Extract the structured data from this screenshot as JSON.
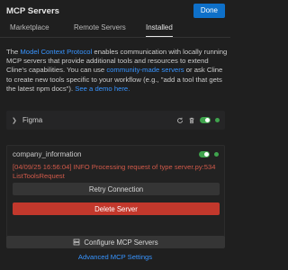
{
  "header": {
    "title": "MCP Servers",
    "done_label": "Done"
  },
  "tabs": [
    {
      "label": "Marketplace",
      "active": false
    },
    {
      "label": "Remote Servers",
      "active": false
    },
    {
      "label": "Installed",
      "active": true
    }
  ],
  "intro": {
    "text_1": "The ",
    "link_1": "Model Context Protocol",
    "text_2": " enables communication with locally running MCP servers that provide additional tools and resources to extend Cline's capabilities. You can use ",
    "link_2": "community-made servers",
    "text_3": " or ask Cline to create new tools specific to your workflow (e.g., \"add a tool that gets the latest npm docs\"). ",
    "link_3": "See a demo here."
  },
  "servers": [
    {
      "name": "Figma",
      "expanded": false,
      "enabled": true,
      "status_color": "#3fa34d",
      "icons": [
        "chevron-right-icon",
        "refresh-icon",
        "trash-icon"
      ]
    },
    {
      "name": "company_information",
      "expanded": true,
      "enabled": true,
      "status_color": "#3fa34d",
      "error_message": "[04/09/25 16:56:04] INFO Processing request of type server.py:534 ListToolsRequest",
      "retry_label": "Retry Connection",
      "delete_label": "Delete Server"
    }
  ],
  "footer": {
    "configure_label": "Configure MCP Servers",
    "configure_icon": "server-icon",
    "advanced_label": "Advanced MCP Settings"
  },
  "colors": {
    "background": "#1f1f1f",
    "accent": "#0e70c9",
    "link": "#3794ff",
    "error": "#d15a4a",
    "danger": "#c2382c",
    "success": "#3fa34d"
  }
}
